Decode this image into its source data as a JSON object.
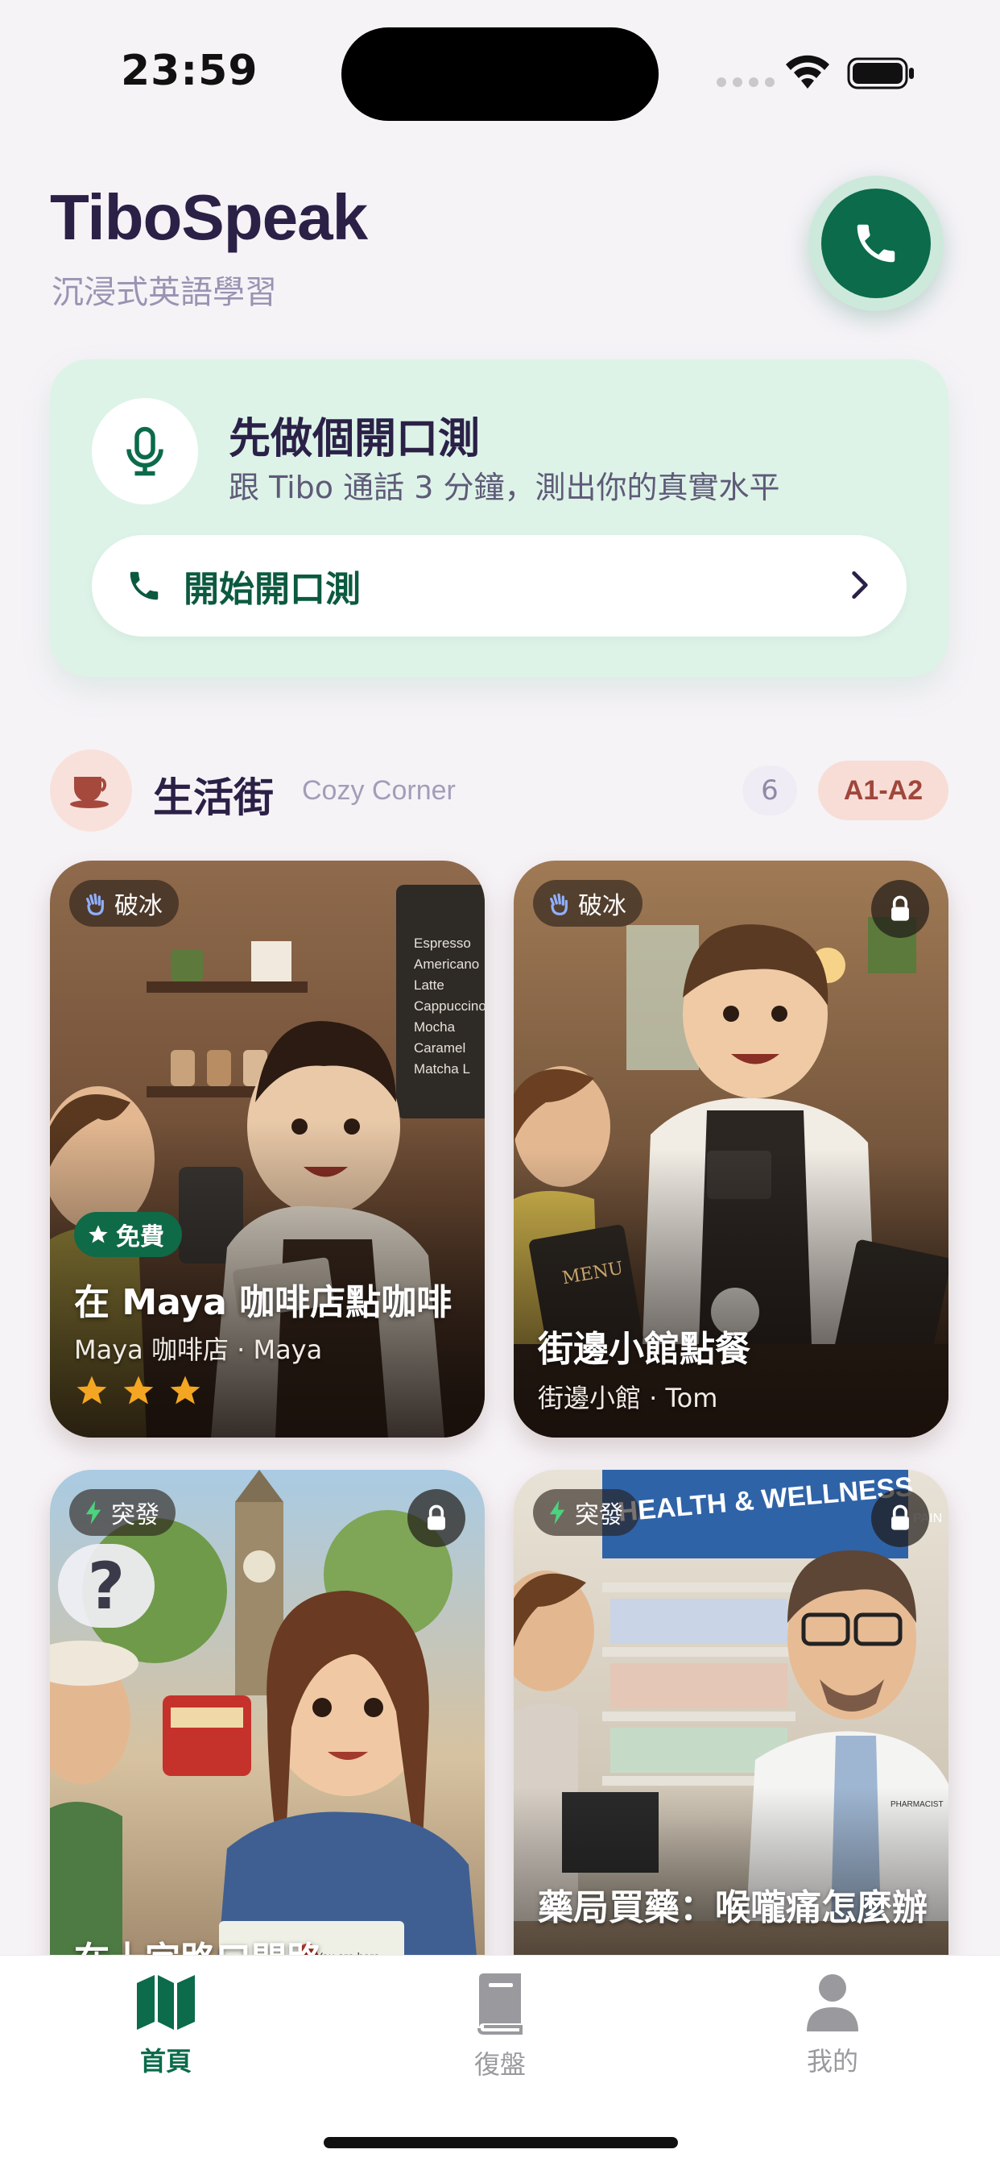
{
  "status_bar": {
    "time": "23:59"
  },
  "header": {
    "title": "TiboSpeak",
    "subtitle": "沉浸式英語學習"
  },
  "test_card": {
    "title": "先做個開口測",
    "description": "跟 Tibo 通話 3 分鐘，測出你的真實水平",
    "button_label": "開始開口測"
  },
  "section": {
    "title": "生活街",
    "subtitle": "Cozy Corner",
    "count": "6",
    "level": "A1-A2"
  },
  "cards": [
    {
      "tag": "破冰",
      "badge": "免費",
      "title": "在 Maya 咖啡店點咖啡",
      "subtitle": "Maya 咖啡店 · Maya",
      "stars": 3,
      "locked": false,
      "menu_board": [
        "Espresso",
        "Americano",
        "Latte",
        "Cappuccino",
        "Mocha",
        "Caramel",
        "Matcha L"
      ]
    },
    {
      "tag": "破冰",
      "title": "街邊小館點餐",
      "subtitle": "街邊小館 · Tom",
      "locked": true,
      "menu_text": "MENU"
    },
    {
      "tag": "突發",
      "title": "在十字路口問路",
      "locked": true,
      "bubble": "?",
      "map_text": "You are here"
    },
    {
      "tag": "突發",
      "title": "藥局買藥：喉嚨痛怎麼辦",
      "locked": true,
      "store_sign": "HEALTH & WELLNESS",
      "sign_small": "PAIN",
      "coat_badge": "PHARMACIST"
    }
  ],
  "tab_bar": {
    "items": [
      {
        "label": "首頁",
        "icon": "map-icon",
        "active": true
      },
      {
        "label": "復盤",
        "icon": "book-icon",
        "active": false
      },
      {
        "label": "我的",
        "icon": "person-icon",
        "active": false
      }
    ]
  },
  "colors": {
    "brand_green": "#0b6b4b",
    "accent_bg": "#ddf3e8",
    "title": "#2b2147",
    "star": "#f4a623"
  }
}
